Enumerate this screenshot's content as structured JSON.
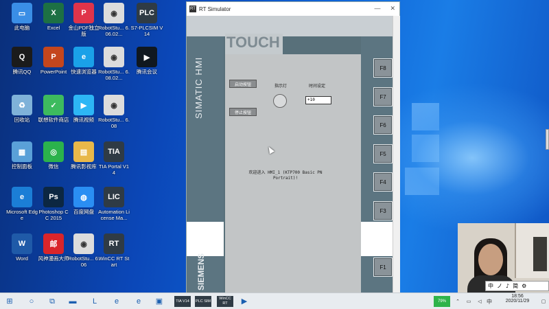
{
  "desktop": {
    "icons": [
      {
        "label": "此电脑",
        "glyph": "▭",
        "color": "#3a8ee6"
      },
      {
        "label": "Excel",
        "glyph": "X",
        "color": "#1d7044"
      },
      {
        "label": "金山PDF独立版",
        "glyph": "P",
        "color": "#e0344a"
      },
      {
        "label": "RobotStu... 6.06.02...",
        "glyph": "◉",
        "color": "#dcdcdc"
      },
      {
        "label": "S7-PLCSIM V14",
        "glyph": "PLC",
        "color": "#2f3b45"
      },
      {
        "label": "腾讯QQ",
        "glyph": "Q",
        "color": "#1b1b1b"
      },
      {
        "label": "PowerPoint",
        "glyph": "P",
        "color": "#c4461d"
      },
      {
        "label": "快速浏览器",
        "glyph": "e",
        "color": "#1aa1e8"
      },
      {
        "label": "RobotStu... 6.08.02...",
        "glyph": "◉",
        "color": "#dcdcdc"
      },
      {
        "label": "腾讯会议",
        "glyph": "▶",
        "color": "#101820"
      },
      {
        "label": "回收站",
        "glyph": "♻",
        "color": "#7fb2d9"
      },
      {
        "label": "联想软件商店",
        "glyph": "✓",
        "color": "#3dbb5e"
      },
      {
        "label": "腾讯视频",
        "glyph": "▶",
        "color": "#2db6f5"
      },
      {
        "label": "RobotStu... 6.08",
        "glyph": "◉",
        "color": "#dcdcdc"
      },
      {
        "label": "控制面板",
        "glyph": "▦",
        "color": "#5aa0d8"
      },
      {
        "label": "微信",
        "glyph": "◎",
        "color": "#2bb24c"
      },
      {
        "label": "腾讯影视库",
        "glyph": "▤",
        "color": "#e8b84a"
      },
      {
        "label": "TIA Portal V14",
        "glyph": "TIA",
        "color": "#2f3b45"
      },
      {
        "label": "Microsoft Edge",
        "glyph": "e",
        "color": "#1b7ed6"
      },
      {
        "label": "Photoshop CC 2015",
        "glyph": "Ps",
        "color": "#0c2742"
      },
      {
        "label": "百度网盘",
        "glyph": "◍",
        "color": "#2a8ef3"
      },
      {
        "label": "Automation License Ma...",
        "glyph": "LIC",
        "color": "#2f3b45"
      },
      {
        "label": "Word",
        "glyph": "W",
        "color": "#1f5aa8"
      },
      {
        "label": "风神漫画大师",
        "glyph": "邮",
        "color": "#d9252a"
      },
      {
        "label": "RobotStu... 6.06",
        "glyph": "◉",
        "color": "#dcdcdc"
      },
      {
        "label": "WinCC RT Start",
        "glyph": "RT",
        "color": "#2f3b45"
      }
    ]
  },
  "simulator": {
    "title": "RT Simulator",
    "app_icon": "RT",
    "close": "✕",
    "minimize": "—",
    "touch_label": "TOUCH",
    "brand_vertical": "SIMATIC HMI",
    "siemens": "SIEMENS",
    "fkeys": [
      "F8",
      "F7",
      "F6",
      "F5",
      "F4",
      "F3",
      "F1"
    ],
    "hmi": {
      "start_button": "启动按钮",
      "stop_button": "停止按钮",
      "indicator_label": "指示灯",
      "time_label": "时间设定",
      "time_value": "+10",
      "welcome": "欢迎进入 HMI_1 (KTP700 Basic PN Portrait)!"
    }
  },
  "taskbar": {
    "items": [
      {
        "name": "windows-start",
        "glyph": "⊞"
      },
      {
        "name": "search",
        "glyph": "○"
      },
      {
        "name": "task-view",
        "glyph": "⧉"
      },
      {
        "name": "file-explorer",
        "glyph": "▬"
      },
      {
        "name": "lenovo",
        "glyph": "L"
      },
      {
        "name": "edge",
        "glyph": "e"
      },
      {
        "name": "browser",
        "glyph": "e"
      },
      {
        "name": "tv",
        "glyph": "▣"
      },
      {
        "name": "tia-portal",
        "glyph": "TIA V14"
      },
      {
        "name": "plcsim",
        "glyph": "PLC SIM"
      },
      {
        "name": "wincc-rt",
        "glyph": "WinCC RT"
      },
      {
        "name": "meeting",
        "glyph": "▶"
      }
    ],
    "battery": "79%",
    "ime": "中",
    "time": "18:56",
    "date": "2020/11/29"
  },
  "ime_bar": {
    "items": [
      "中",
      "ノ",
      "♪",
      "简",
      "⚙"
    ]
  }
}
